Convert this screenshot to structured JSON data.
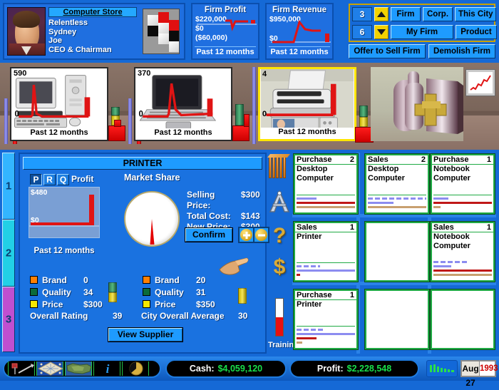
{
  "firm": {
    "store_title": "Computer Store",
    "name": "Relentless",
    "city": "Sydney",
    "owner": "Joe",
    "role": "CEO & Chairman",
    "portrait_name": "executive-portrait",
    "logo_name": "cube-logo"
  },
  "charts": {
    "profit": {
      "title": "Firm Profit",
      "top": "$220,000",
      "mid": "$0",
      "bottom": "($60,000)",
      "footer": "Past 12 months"
    },
    "revenue": {
      "title": "Firm Revenue",
      "top": "$950,000",
      "bottom": "$0",
      "footer": "Past 12 months"
    }
  },
  "controls": {
    "num_top": "3",
    "num_bottom": "6",
    "up_arrow": "up-arrow-icon",
    "down_arrow": "down-arrow-icon",
    "buttons_row1": [
      "Firm",
      "Corp.",
      "This City"
    ],
    "buttons_row2": [
      "My Firm",
      "Product"
    ],
    "offer_to_sell": "Offer to Sell Firm",
    "demolish": "Demolish Firm"
  },
  "shelf": {
    "products": [
      {
        "count": "590",
        "footer": "Past 12 months",
        "image": "desktop-computer",
        "selected": false
      },
      {
        "count": "370",
        "footer": "Past 12 months",
        "image": "notebook-computer",
        "selected": false
      },
      {
        "count": "4",
        "footer": "Past 12 months",
        "image": "printer",
        "selected": true
      }
    ],
    "decor_name": "store-display-shelf",
    "picture_name": "wall-chart-picture"
  },
  "tabs": [
    {
      "label": "1",
      "color": "#33b5ff"
    },
    {
      "label": "2",
      "color": "#22d0e6"
    },
    {
      "label": "3",
      "color": "#c04fd0"
    }
  ],
  "product_panel": {
    "title": "PRINTER",
    "prq": [
      {
        "label": "P",
        "active": true
      },
      {
        "label": "R",
        "active": false
      },
      {
        "label": "Q",
        "active": false
      }
    ],
    "profit_label": "Profit",
    "market_share_label": "Market Share",
    "profit_chart": {
      "top": "$480",
      "bottom": "$0",
      "footer": "Past 12 months"
    },
    "market_share_percent": 4,
    "price_rows": [
      {
        "key": "Selling Price:",
        "value": "$300"
      },
      {
        "key": "Total Cost:",
        "value": "$143"
      },
      {
        "key": "New Price:",
        "value": "$300"
      }
    ],
    "confirm": "Confirm",
    "plus_icon": "plus-button-icon",
    "minus_icon": "minus-button-icon",
    "cursor_icon": "pointing-hand-cursor",
    "ratings_mine": [
      {
        "color": "#ff8000",
        "name": "Brand",
        "value": "0"
      },
      {
        "color": "#0b6b3a",
        "name": "Quality",
        "value": "34"
      },
      {
        "color": "#f5e800",
        "name": "Price",
        "value": "$300"
      }
    ],
    "ratings_city": [
      {
        "color": "#ff8000",
        "name": "Brand",
        "value": "20"
      },
      {
        "color": "#0b6b3a",
        "name": "Quality",
        "value": "31"
      },
      {
        "color": "#f5e800",
        "name": "Price",
        "value": "$350"
      }
    ],
    "overall_rating_label": "Overall Rating",
    "overall_rating_value": "39",
    "city_average_label": "City Overall Average",
    "city_average_value": "30",
    "view_supplier": "View Supplier"
  },
  "strip": {
    "icons": [
      "books-icon",
      "blueprint-icon",
      "question-mark-icon",
      "dollar-sign-icon",
      "thermometer-icon"
    ],
    "training_label": "Training",
    "training_level": 50
  },
  "grid": {
    "cards": [
      {
        "type": "Purchase",
        "num": "2",
        "lines": [
          "Desktop",
          "Computer"
        ],
        "bars": [
          "blue-short",
          "red-full",
          "tan-full"
        ]
      },
      {
        "type": "Sales",
        "num": "2",
        "lines": [
          "Desktop",
          "Computer"
        ],
        "bars": [
          "dash-full",
          "blue-mid",
          "tan-full"
        ]
      },
      {
        "type": "Purchase",
        "num": "1",
        "lines": [
          "Notebook",
          "Computer"
        ],
        "bars": [
          "blue-short",
          "red-full",
          "tan-short"
        ]
      },
      {
        "type": "Sales",
        "num": "1",
        "lines": [
          "Printer"
        ],
        "bars": [
          "dash-short",
          "blue-full",
          "red-tiny"
        ]
      },
      {
        "type": "",
        "num": "",
        "lines": [],
        "bars": []
      },
      {
        "type": "Sales",
        "num": "1",
        "lines": [
          "Notebook",
          "Computer"
        ],
        "bars": [
          "dash-mid",
          "blue-short",
          "red-full",
          "tan-full"
        ]
      },
      {
        "type": "Purchase",
        "num": "1",
        "lines": [
          "Printer"
        ],
        "bars": [
          "dash-mid",
          "blue-full",
          "red-mid",
          "tan-tiny"
        ]
      },
      {
        "type": "",
        "num": "",
        "lines": [],
        "bars": []
      },
      {
        "type": "",
        "num": "",
        "lines": [],
        "bars": []
      }
    ]
  },
  "statusbar": {
    "icons": [
      "tools-icon",
      "board-game-icon",
      "map-icon",
      "info-icon",
      "clock-icon"
    ],
    "cash_label": "Cash:",
    "cash_value": "$4,059,120",
    "profit_label": "Profit:",
    "profit_value": "$2,228,548",
    "speed_icon": "speed-bars-icon",
    "date": "Aug 27",
    "year": "1993"
  }
}
